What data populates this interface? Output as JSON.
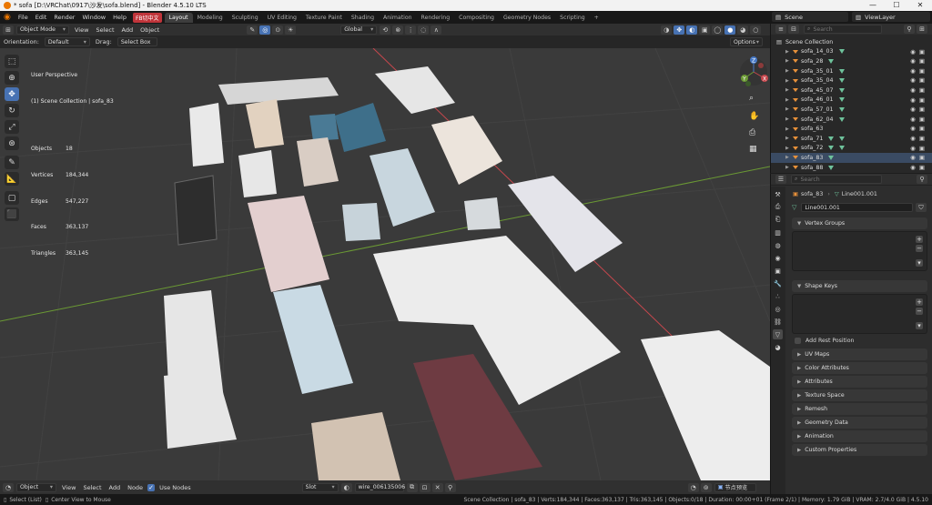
{
  "window": {
    "title": "* sofa [D:\\VRChat\\0917\\沙发\\sofa.blend] - Blender 4.5.10 LTS",
    "controls": [
      "—",
      "☐",
      "✕"
    ]
  },
  "menu": {
    "items": [
      "File",
      "Edit",
      "Render",
      "Window",
      "Help"
    ],
    "chip": "FB切中文"
  },
  "workspaces": [
    "Layout",
    "Modeling",
    "Sculpting",
    "UV Editing",
    "Texture Paint",
    "Shading",
    "Animation",
    "Rendering",
    "Compositing",
    "Geometry Nodes",
    "Scripting",
    "+"
  ],
  "scene": {
    "label": "Scene",
    "view_layer": "ViewLayer"
  },
  "header": {
    "mode": "Object Mode",
    "menus": [
      "View",
      "Select",
      "Add",
      "Object"
    ],
    "transform": "Global"
  },
  "header2": {
    "orientation_label": "Orientation:",
    "orientation": "Default",
    "drag_label": "Drag:",
    "drag": "Select Box",
    "options": "Options"
  },
  "viewport": {
    "title": "User Perspective",
    "subtitle": "(1) Scene Collection | sofa_83",
    "stats": [
      [
        "Objects",
        "18"
      ],
      [
        "Vertices",
        "184,344"
      ],
      [
        "Edges",
        "547,227"
      ],
      [
        "Faces",
        "363,137"
      ],
      [
        "Triangles",
        "363,145"
      ]
    ]
  },
  "gizmo": {
    "x": "X",
    "y": "Y",
    "z": "Z"
  },
  "bottom_header": {
    "editor": "Object",
    "menus": [
      "View",
      "Select",
      "Add",
      "Node"
    ],
    "use_nodes": "Use Nodes",
    "slot": "Slot",
    "material": "wire_006135006",
    "extra": "节点预览"
  },
  "outliner": {
    "search_placeholder": "Search",
    "root": "Scene Collection",
    "rows": [
      {
        "name": "sofa_14_03",
        "mods": 1
      },
      {
        "name": "sofa_28",
        "mods": 1
      },
      {
        "name": "sofa_35_01",
        "mods": 1
      },
      {
        "name": "sofa_35_04",
        "mods": 1
      },
      {
        "name": "sofa_45_07",
        "mods": 1
      },
      {
        "name": "sofa_46_01",
        "mods": 1
      },
      {
        "name": "sofa_57_01",
        "mods": 1
      },
      {
        "name": "sofa_62_04",
        "mods": 1
      },
      {
        "name": "sofa_63",
        "mods": 0
      },
      {
        "name": "sofa_71",
        "mods": 2
      },
      {
        "name": "sofa_72",
        "mods": 2
      },
      {
        "name": "sofa_83",
        "mods": 1,
        "selected": true
      },
      {
        "name": "sofa_88",
        "mods": 1
      }
    ]
  },
  "properties": {
    "search_placeholder": "Search",
    "object": "sofa_83",
    "mesh": "Line001.001",
    "mesh_field": "Line001.001",
    "panels_open": [
      "Vertex Groups",
      "Shape Keys"
    ],
    "add_rest_position": "Add Rest Position",
    "panels": [
      "UV Maps",
      "Color Attributes",
      "Attributes",
      "Texture Space",
      "Remesh",
      "Geometry Data",
      "Animation",
      "Custom Properties"
    ]
  },
  "status": {
    "left": [
      "Select (List)",
      "Center View to Mouse"
    ],
    "right": "Scene Collection | sofa_83 | Verts:184,344 | Faces:363,137 | Tris:363,145 | Objects:0/18 | Duration: 00:00+01 (Frame 2/1) | Memory: 1.79 GiB | VRAM: 2.7/4.0 GiB | 4.5.10"
  },
  "colors": {
    "accent": "#4772b3",
    "viewport_bg": "#3a3a3a",
    "object_orange": "#e8913a",
    "modifier_green": "#6ec29b",
    "axis_red": "#c6474d",
    "axis_green": "#6b9a34"
  }
}
